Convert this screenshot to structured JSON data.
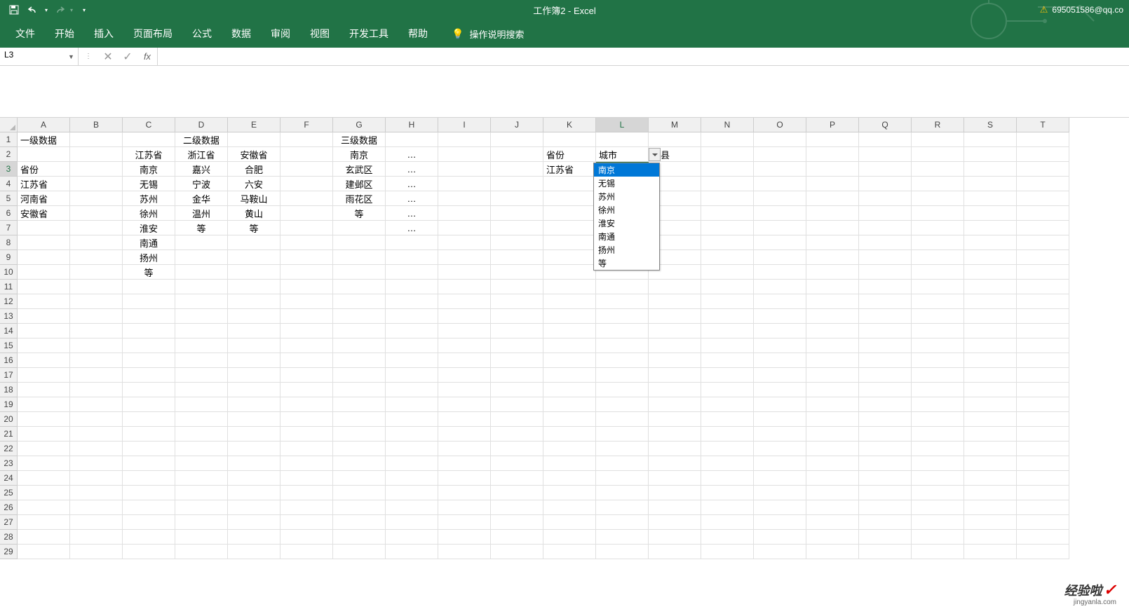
{
  "title": "工作簿2  -  Excel",
  "account": "695051586@qq.co",
  "qat": {
    "save": "💾",
    "undo": "↶",
    "redo": "↷"
  },
  "ribbon": {
    "tabs": [
      "文件",
      "开始",
      "插入",
      "页面布局",
      "公式",
      "数据",
      "审阅",
      "视图",
      "开发工具",
      "帮助"
    ],
    "tellme": "操作说明搜索"
  },
  "namebox": "L3",
  "formula": "",
  "columns": [
    "A",
    "B",
    "C",
    "D",
    "E",
    "F",
    "G",
    "H",
    "I",
    "J",
    "K",
    "L",
    "M",
    "N",
    "O",
    "P",
    "Q",
    "R",
    "S",
    "T"
  ],
  "rows": [
    "1",
    "2",
    "3",
    "4",
    "5",
    "6",
    "7",
    "8",
    "9",
    "10",
    "11",
    "12",
    "13",
    "14",
    "15",
    "16",
    "17",
    "18",
    "19",
    "20",
    "21",
    "22",
    "23",
    "24",
    "25",
    "26",
    "27",
    "28",
    "29"
  ],
  "selected_col": "L",
  "selected_row": "3",
  "dropdown": {
    "items": [
      "南京",
      "无锡",
      "苏州",
      "徐州",
      "淮安",
      "南通",
      "扬州",
      "等"
    ],
    "highlighted": 0
  },
  "sheet": {
    "A1": "一级数据",
    "D1": "二级数据",
    "G1": "三级数据",
    "C2": "江苏省",
    "D2": "浙江省",
    "E2": "安徽省",
    "G2": "南京",
    "H2": "…",
    "K2": "省份",
    "L2": "城市",
    "M2": "区县",
    "A3": "省份",
    "C3": "南京",
    "D3": "嘉兴",
    "E3": "合肥",
    "G3": "玄武区",
    "H3": "…",
    "K3": "江苏省",
    "A4": "江苏省",
    "C4": "无锡",
    "D4": "宁波",
    "E4": "六安",
    "G4": "建邺区",
    "H4": "…",
    "A5": "河南省",
    "C5": "苏州",
    "D5": "金华",
    "E5": "马鞍山",
    "G5": "雨花区",
    "H5": "…",
    "A6": "安徽省",
    "C6": "徐州",
    "D6": "温州",
    "E6": "黄山",
    "G6": "等",
    "H6": "…",
    "C7": "淮安",
    "D7": "等",
    "E7": "等",
    "H7": "…",
    "C8": "南通",
    "C9": "扬州",
    "C10": "等"
  },
  "watermark": {
    "main": "经验啦",
    "check": "✓",
    "sub": "jingyanla.com"
  }
}
